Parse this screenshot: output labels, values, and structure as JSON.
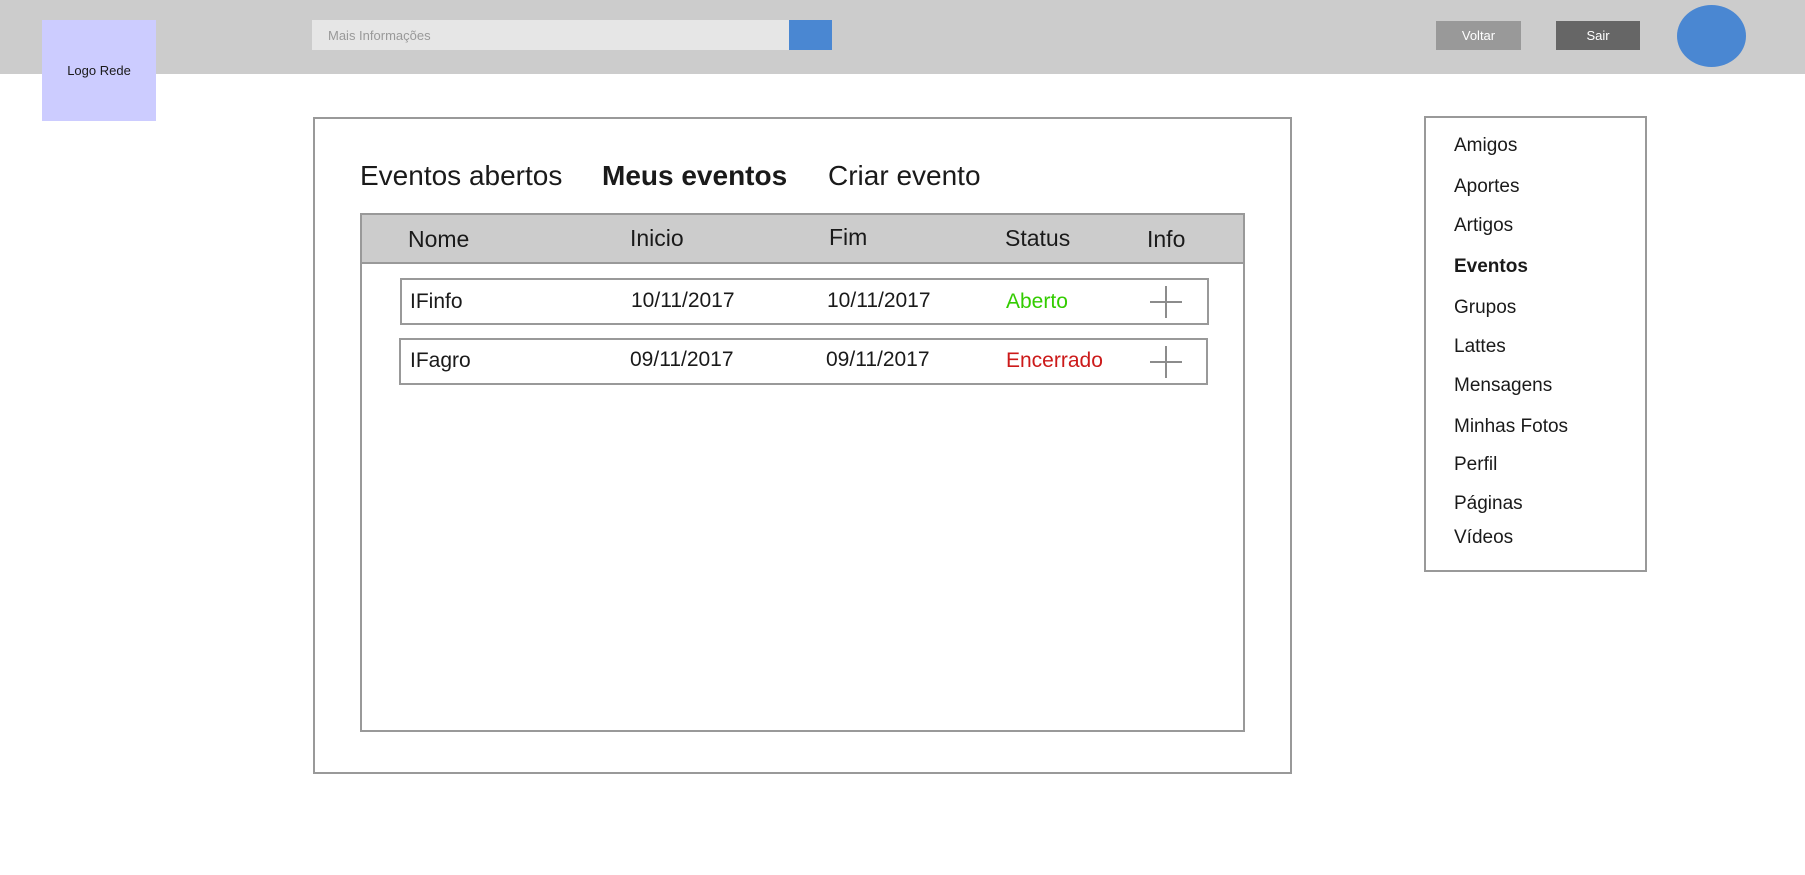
{
  "header": {
    "logo_label": "Logo Rede",
    "search_placeholder": "Mais Informações",
    "back_label": "Voltar",
    "logout_label": "Sair",
    "accent_color": "#4a87d2"
  },
  "tabs": [
    {
      "label": "Eventos abertos",
      "active": false
    },
    {
      "label": "Meus eventos",
      "active": true
    },
    {
      "label": "Criar evento",
      "active": false
    }
  ],
  "table": {
    "columns": [
      "Nome",
      "Inicio",
      "Fim",
      "Status",
      "Info"
    ],
    "rows": [
      {
        "nome": "IFinfo",
        "inicio": "10/11/2017",
        "fim": "10/11/2017",
        "status": "Aberto",
        "status_color": "#33cc00",
        "info_icon": "plus-icon"
      },
      {
        "nome": "IFagro",
        "inicio": "09/11/2017",
        "fim": "09/11/2017",
        "status": "Encerrado",
        "status_color": "#cc1a1a",
        "info_icon": "plus-icon"
      }
    ]
  },
  "sidebar": {
    "items": [
      {
        "label": "Amigos"
      },
      {
        "label": "Aportes"
      },
      {
        "label": "Artigos"
      },
      {
        "label": "Eventos",
        "active": true
      },
      {
        "label": "Grupos"
      },
      {
        "label": "Lattes"
      },
      {
        "label": "Mensagens"
      },
      {
        "label": "Minhas Fotos"
      },
      {
        "label": "Perfil"
      },
      {
        "label": "Páginas"
      },
      {
        "label": "Vídeos"
      }
    ]
  }
}
